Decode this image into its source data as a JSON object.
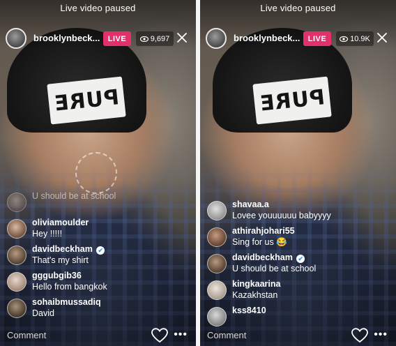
{
  "left": {
    "status_text": "Live video paused",
    "username": "brooklynbeck...",
    "live_label": "LIVE",
    "viewer_count": "9,697",
    "beanie_text": "PURE",
    "comments": [
      {
        "user": "",
        "text": "U should be at school"
      },
      {
        "user": "oliviamoulder",
        "text": "Hey !!!!!"
      },
      {
        "user": "davidbeckham",
        "text": "That's my shirt",
        "verified": true
      },
      {
        "user": "gggubgib36",
        "text": "Hello from bangkok"
      },
      {
        "user": "sohaibmussadiq",
        "text": "David"
      }
    ],
    "comment_placeholder": "Comment"
  },
  "right": {
    "status_text": "Live video paused",
    "username": "brooklynbeck...",
    "live_label": "LIVE",
    "viewer_count": "10.9K",
    "beanie_text": "PURE",
    "comments": [
      {
        "user": "shavaa.a",
        "text": "Lovee youuuuuu babyyyy"
      },
      {
        "user": "athirahjohari55",
        "text": "Sing for us 😂"
      },
      {
        "user": "davidbeckham",
        "text": "U should be at school",
        "verified": true
      },
      {
        "user": "kingkaarina",
        "text": "Kazakhstan"
      },
      {
        "user": "kss8410",
        "text": ""
      }
    ],
    "comment_placeholder": "Comment"
  },
  "icons": {
    "verified": "verified-badge-icon",
    "viewers": "eye-icon",
    "close": "close-icon",
    "like": "heart-icon",
    "more": "more-options-icon"
  },
  "colors": {
    "live_badge": "#e1306c",
    "verified": "#3797f0"
  }
}
